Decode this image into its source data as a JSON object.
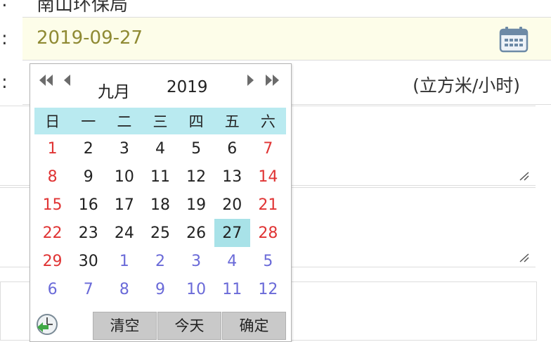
{
  "form": {
    "top_field_text": "南山环保局",
    "date_value": "2019-09-27",
    "unit_text": "(立方米/小时)",
    "colons": [
      ":",
      ":",
      ":"
    ]
  },
  "calendar": {
    "month_label": "九月",
    "year_label": "2019",
    "weekday_headers": [
      "日",
      "一",
      "二",
      "三",
      "四",
      "五",
      "六"
    ],
    "weeks": [
      [
        "1",
        "2",
        "3",
        "4",
        "5",
        "6",
        "7"
      ],
      [
        "8",
        "9",
        "10",
        "11",
        "12",
        "13",
        "14"
      ],
      [
        "15",
        "16",
        "17",
        "18",
        "19",
        "20",
        "21"
      ],
      [
        "22",
        "23",
        "24",
        "25",
        "26",
        "27",
        "28"
      ],
      [
        "29",
        "30",
        "1",
        "2",
        "3",
        "4",
        "5"
      ],
      [
        "6",
        "7",
        "8",
        "9",
        "10",
        "11",
        "12"
      ]
    ],
    "selected_day": "27",
    "buttons": {
      "clear": "清空",
      "today": "今天",
      "ok": "确定"
    },
    "colors": {
      "weekend": "#e03434",
      "other_month": "#6a6ad8",
      "header_bg": "#b9eaf0",
      "selected_bg": "#a8e2e8"
    },
    "icons": [
      "double-left-arrow-icon",
      "left-arrow-icon",
      "right-arrow-icon",
      "double-right-arrow-icon",
      "clock-icon",
      "calendar-icon",
      "resize-handle-icon"
    ]
  }
}
